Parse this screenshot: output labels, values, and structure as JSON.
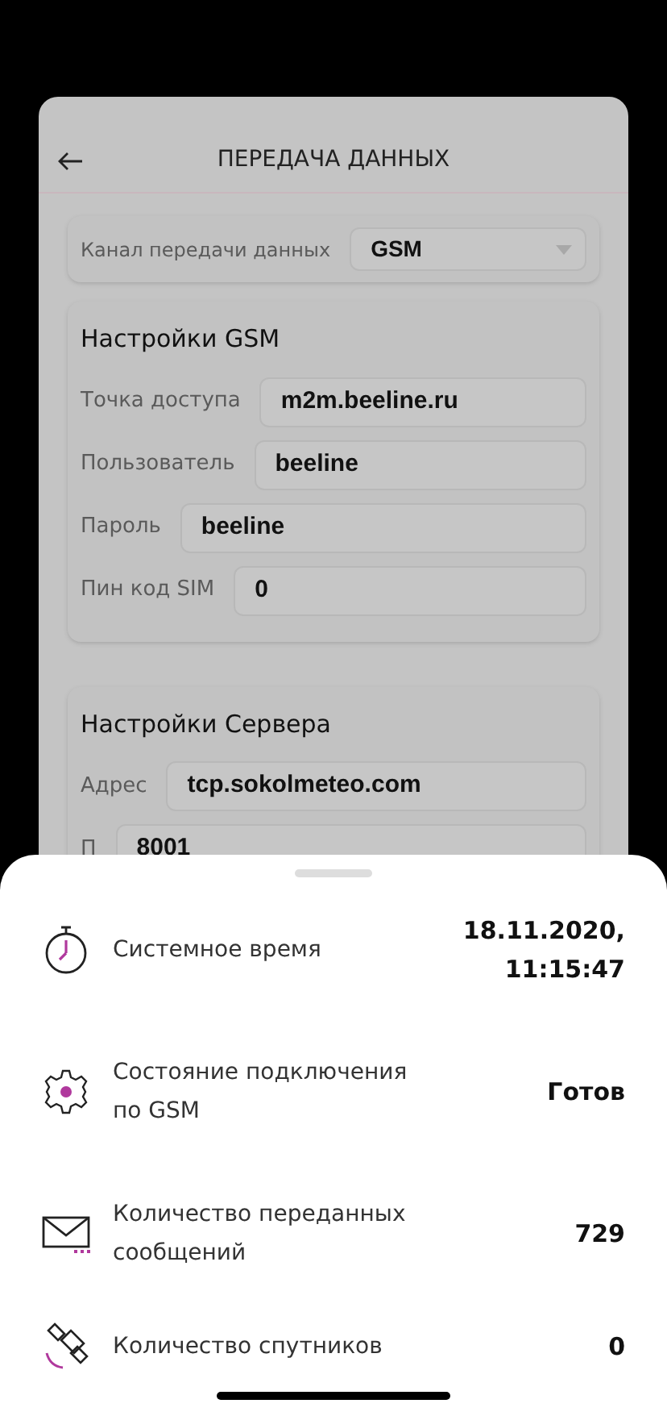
{
  "screen": {
    "title": "ПЕРЕДАЧА ДАННЫХ"
  },
  "channel": {
    "label": "Канал передачи данных",
    "value": "GSM"
  },
  "sections": [
    {
      "title": "Настройки GSM",
      "fields": [
        {
          "label": "Точка доступа",
          "value": "m2m.beeline.ru"
        },
        {
          "label": "Пользователь",
          "value": "beeline"
        },
        {
          "label": "Пароль",
          "value": "beeline"
        },
        {
          "label": "Пин код SIM",
          "value": "0"
        }
      ]
    },
    {
      "title": "Настройки Сервера",
      "fields": [
        {
          "label": "Адрес",
          "value": "tcp.sokolmeteo.com"
        },
        {
          "label": "П",
          "value": "8001"
        }
      ]
    }
  ],
  "status": [
    {
      "kind": "clock",
      "label": "Системное время",
      "value": "18.11.2020,\n11:15:47"
    },
    {
      "kind": "gear",
      "label": "Состояние подключения\nпо GSM",
      "value": "Готов"
    },
    {
      "kind": "mail",
      "label": "Количество переданных\nсообщений",
      "value": "729"
    },
    {
      "kind": "satellite",
      "label": "Количество спутников",
      "value": "0"
    }
  ]
}
